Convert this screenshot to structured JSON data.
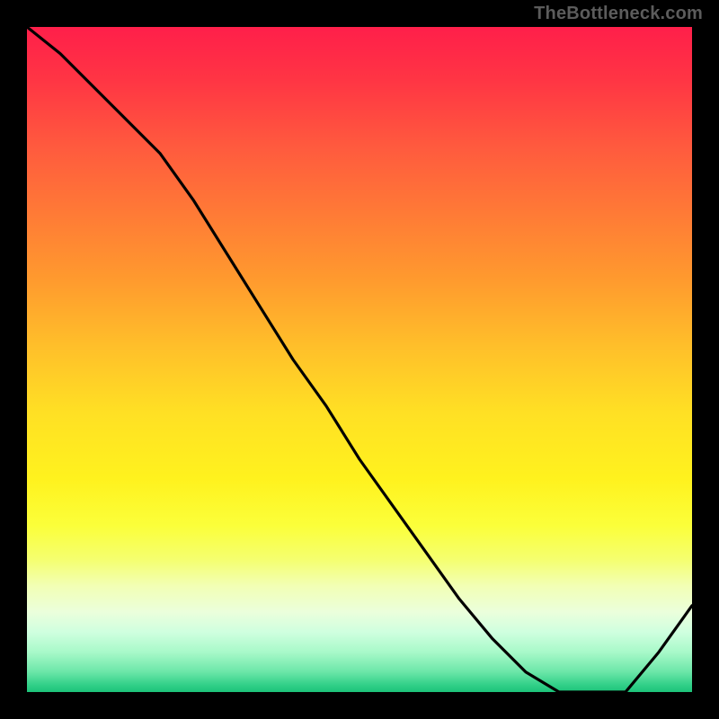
{
  "attribution": "TheBottleneck.com",
  "marker_label_text": "",
  "colors": {
    "curve_stroke": "#000000",
    "marker_text": "#b03030"
  },
  "chart_data": {
    "type": "line",
    "title": "",
    "xlabel": "",
    "ylabel": "",
    "xlim": [
      0,
      100
    ],
    "ylim": [
      0,
      100
    ],
    "grid": false,
    "legend": false,
    "annotations": [
      "highlighted optimum segment near x≈80–90"
    ],
    "x": [
      0,
      5,
      10,
      15,
      20,
      25,
      30,
      35,
      40,
      45,
      50,
      55,
      60,
      65,
      70,
      75,
      80,
      85,
      90,
      95,
      100
    ],
    "values": [
      100,
      96,
      91,
      86,
      81,
      74,
      66,
      58,
      50,
      43,
      35,
      28,
      21,
      14,
      8,
      3,
      0,
      0,
      0,
      6,
      13
    ]
  }
}
